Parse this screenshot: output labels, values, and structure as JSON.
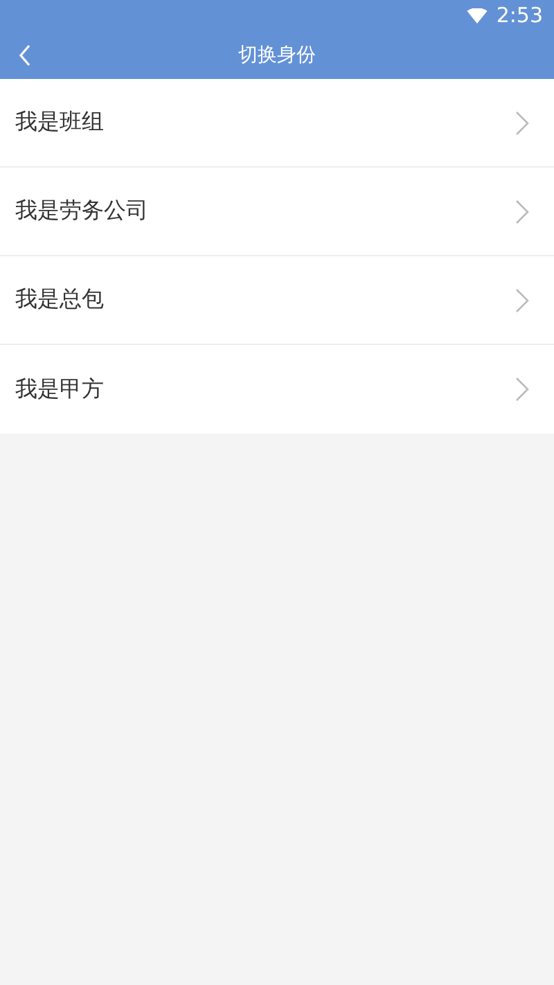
{
  "status_bar": {
    "time": "2:53"
  },
  "nav_bar": {
    "title": "切换身份"
  },
  "items": [
    {
      "label": "我是班组"
    },
    {
      "label": "我是劳务公司"
    },
    {
      "label": "我是总包"
    },
    {
      "label": "我是甲方"
    }
  ]
}
